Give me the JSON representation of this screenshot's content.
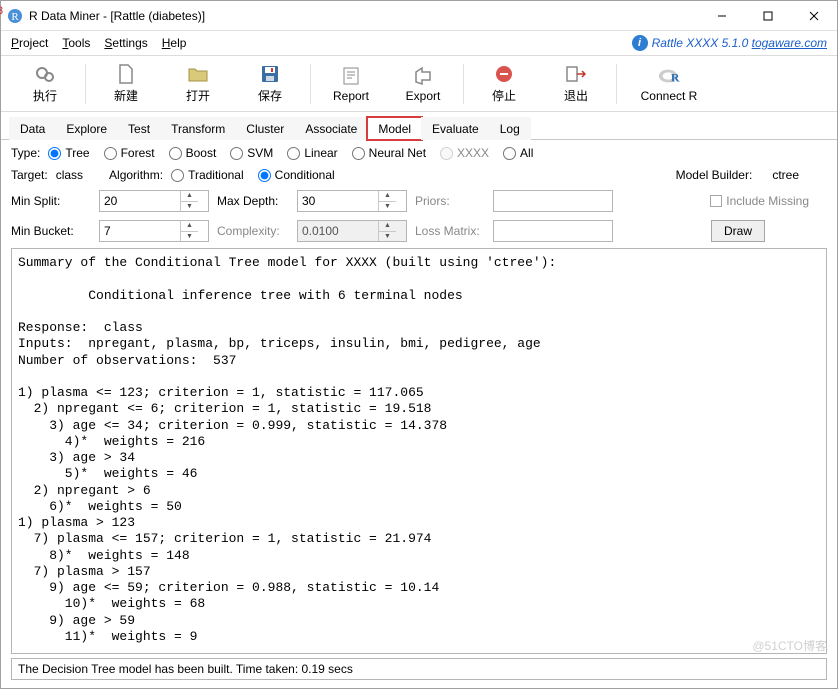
{
  "window": {
    "title": "R Data Miner - [Rattle (diabetes)]"
  },
  "menu": {
    "project": "Project",
    "tools": "Tools",
    "settings": "Settings",
    "help": "Help",
    "version_text": "Rattle XXXX 5.1.0 ",
    "version_link": "togaware.com"
  },
  "toolbar": {
    "run": "执行",
    "new": "新建",
    "open": "打开",
    "save": "保存",
    "report": "Report",
    "export": "Export",
    "stop": "停止",
    "quit": "退出",
    "connect": "Connect R"
  },
  "tabs": {
    "items": [
      "Data",
      "Explore",
      "Test",
      "Transform",
      "Cluster",
      "Associate",
      "Model",
      "Evaluate",
      "Log"
    ],
    "active": "Model"
  },
  "type_row": {
    "label": "Type:",
    "options": [
      "Tree",
      "Forest",
      "Boost",
      "SVM",
      "Linear",
      "Neural Net",
      "XXXX",
      "All"
    ],
    "selected": "Tree"
  },
  "target_row": {
    "target_label": "Target:",
    "target_value": "class",
    "algo_label": "Algorithm:",
    "algo_options": [
      "Traditional",
      "Conditional"
    ],
    "algo_selected": "Conditional",
    "builder_label": "Model Builder:",
    "builder_value": "ctree"
  },
  "params": {
    "minsplit_label": "Min Split:",
    "minsplit": "20",
    "maxdepth_label": "Max Depth:",
    "maxdepth": "30",
    "priors_label": "Priors:",
    "include_missing_label": "Include Missing",
    "minbucket_label": "Min Bucket:",
    "minbucket": "7",
    "complexity_label": "Complexity:",
    "complexity": "0.0100",
    "lossmatrix_label": "Loss Matrix:",
    "draw_label": "Draw"
  },
  "output_text": "Summary of the Conditional Tree model for XXXX (built using 'ctree'):\n\n\t Conditional inference tree with 6 terminal nodes\n\nResponse:  class\nInputs:  npregant, plasma, bp, triceps, insulin, bmi, pedigree, age\nNumber of observations:  537\n\n1) plasma <= 123; criterion = 1, statistic = 117.065\n  2) npregant <= 6; criterion = 1, statistic = 19.518\n    3) age <= 34; criterion = 0.999, statistic = 14.378\n      4)*  weights = 216\n    3) age > 34\n      5)*  weights = 46\n  2) npregant > 6\n    6)*  weights = 50\n1) plasma > 123\n  7) plasma <= 157; criterion = 1, statistic = 21.974\n    8)*  weights = 148\n  7) plasma > 157\n    9) age <= 59; criterion = 0.988, statistic = 10.14\n      10)*  weights = 68\n    9) age > 59\n      11)*  weights = 9",
  "status": "The Decision Tree model has been built. Time taken: 0.19 secs",
  "watermark": "@51CTO博客"
}
